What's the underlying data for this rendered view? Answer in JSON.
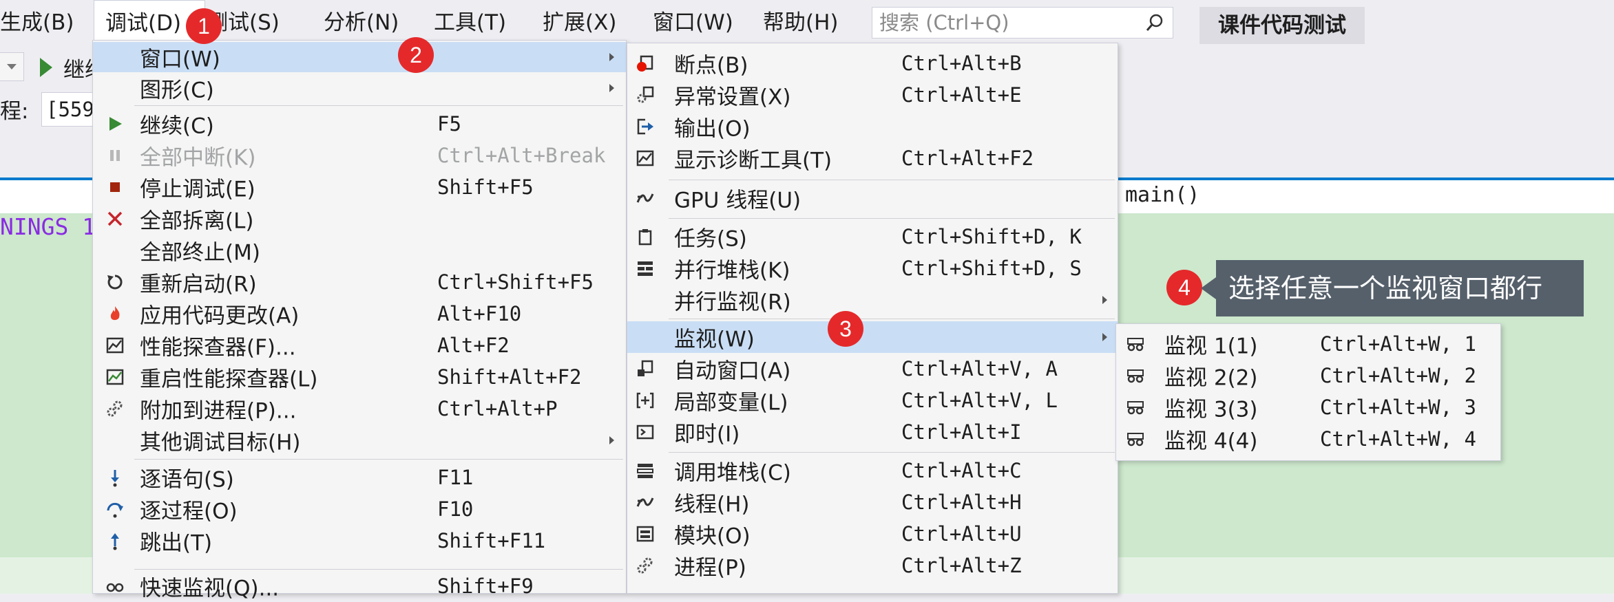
{
  "menubar": {
    "items": [
      "生成(B)",
      "调试(D)",
      "测试(S)",
      "分析(N)",
      "工具(T)",
      "扩展(X)",
      "窗口(W)",
      "帮助(H)"
    ],
    "search_placeholder": "搜索 (Ctrl+Q)",
    "project_name": "课件代码测试"
  },
  "toolbar": {
    "continue_label": "继续",
    "process_label": "程:",
    "process_value": "[559"
  },
  "editor": {
    "code_left": "NINGS 1",
    "code_right": "main()"
  },
  "debug_menu": {
    "items": [
      {
        "label": "窗口(W)",
        "shortcut": ""
      },
      {
        "label": "图形(C)",
        "shortcut": ""
      },
      {
        "label": "继续(C)",
        "shortcut": "F5"
      },
      {
        "label": "全部中断(K)",
        "shortcut": "Ctrl+Alt+Break"
      },
      {
        "label": "停止调试(E)",
        "shortcut": "Shift+F5"
      },
      {
        "label": "全部拆离(L)",
        "shortcut": ""
      },
      {
        "label": "全部终止(M)",
        "shortcut": ""
      },
      {
        "label": "重新启动(R)",
        "shortcut": "Ctrl+Shift+F5"
      },
      {
        "label": "应用代码更改(A)",
        "shortcut": "Alt+F10"
      },
      {
        "label": "性能探查器(F)...",
        "shortcut": "Alt+F2"
      },
      {
        "label": "重启性能探查器(L)",
        "shortcut": "Shift+Alt+F2"
      },
      {
        "label": "附加到进程(P)...",
        "shortcut": "Ctrl+Alt+P"
      },
      {
        "label": "其他调试目标(H)",
        "shortcut": ""
      },
      {
        "label": "逐语句(S)",
        "shortcut": "F11"
      },
      {
        "label": "逐过程(O)",
        "shortcut": "F10"
      },
      {
        "label": "跳出(T)",
        "shortcut": "Shift+F11"
      },
      {
        "label": "快速监视(Q)...",
        "shortcut": "Shift+F9"
      }
    ]
  },
  "window_menu": {
    "items": [
      {
        "label": "断点(B)",
        "shortcut": "Ctrl+Alt+B"
      },
      {
        "label": "异常设置(X)",
        "shortcut": "Ctrl+Alt+E"
      },
      {
        "label": "输出(O)",
        "shortcut": ""
      },
      {
        "label": "显示诊断工具(T)",
        "shortcut": "Ctrl+Alt+F2"
      },
      {
        "label": "GPU 线程(U)",
        "shortcut": ""
      },
      {
        "label": "任务(S)",
        "shortcut": "Ctrl+Shift+D, K"
      },
      {
        "label": "并行堆栈(K)",
        "shortcut": "Ctrl+Shift+D, S"
      },
      {
        "label": "并行监视(R)",
        "shortcut": ""
      },
      {
        "label": "监视(W)",
        "shortcut": ""
      },
      {
        "label": "自动窗口(A)",
        "shortcut": "Ctrl+Alt+V, A"
      },
      {
        "label": "局部变量(L)",
        "shortcut": "Ctrl+Alt+V, L"
      },
      {
        "label": "即时(I)",
        "shortcut": "Ctrl+Alt+I"
      },
      {
        "label": "调用堆栈(C)",
        "shortcut": "Ctrl+Alt+C"
      },
      {
        "label": "线程(H)",
        "shortcut": "Ctrl+Alt+H"
      },
      {
        "label": "模块(O)",
        "shortcut": "Ctrl+Alt+U"
      },
      {
        "label": "进程(P)",
        "shortcut": "Ctrl+Alt+Z"
      }
    ]
  },
  "watch_menu": {
    "items": [
      {
        "label": "监视 1(1)",
        "shortcut": "Ctrl+Alt+W, 1"
      },
      {
        "label": "监视 2(2)",
        "shortcut": "Ctrl+Alt+W, 2"
      },
      {
        "label": "监视 3(3)",
        "shortcut": "Ctrl+Alt+W, 3"
      },
      {
        "label": "监视 4(4)",
        "shortcut": "Ctrl+Alt+W, 4"
      }
    ]
  },
  "annotations": {
    "badges": [
      "1",
      "2",
      "3",
      "4"
    ],
    "callout": "选择任意一个监视窗口都行"
  },
  "colors": {
    "highlight": "#c9def5",
    "badge": "#e5292b",
    "callout_bg": "#56606b",
    "accent_blue": "#007acc",
    "editor_bg": "#cde8cd"
  }
}
